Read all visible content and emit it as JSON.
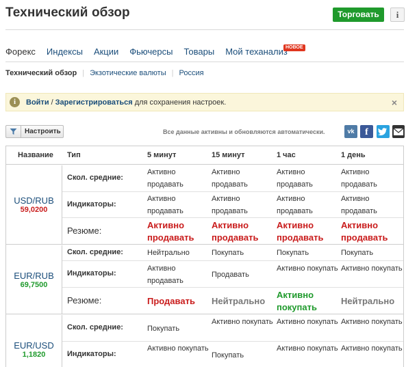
{
  "header": {
    "title": "Технический обзор",
    "trade_label": "Торговать",
    "info_label": "i"
  },
  "nav": {
    "tabs": [
      "Форекс",
      "Индексы",
      "Акции",
      "Фьючерсы",
      "Товары",
      "Мой теханализ"
    ],
    "new_badge": "НОВОЕ"
  },
  "subnav": {
    "items": [
      "Технический обзор",
      "Экзотические валюты",
      "Россия"
    ]
  },
  "notice": {
    "icon": "info-circle-icon",
    "login": "Войти",
    "separator": "/",
    "register": "Зарегистрироваться",
    "rest": "для сохранения настроек.",
    "close": "×"
  },
  "toolbar": {
    "configure_label": "Настроить",
    "auto_text": "Все данные активны и обновляются автоматически.",
    "share_icons": [
      "vk-icon",
      "facebook-icon",
      "twitter-icon",
      "mail-icon"
    ],
    "vk": "vk",
    "fb": "f"
  },
  "table": {
    "headers": [
      "Название",
      "Тип",
      "5 минут",
      "15 минут",
      "1 час",
      "1 день"
    ],
    "labels": {
      "ma": "Скол. средние:",
      "ind": "Индикаторы:",
      "sum": "Резюме:"
    },
    "groups": [
      {
        "pair": "USD/RUB",
        "price": "59,0200",
        "price_color": "#c91c1c",
        "ma": [
          "Активно продавать",
          "Активно продавать",
          "Активно продавать",
          "Активно продавать"
        ],
        "ind": [
          "Активно продавать",
          "Активно продавать",
          "Активно продавать",
          "Активно продавать"
        ],
        "sum": [
          "Активно продавать",
          "Активно продавать",
          "Активно продавать",
          "Активно продавать"
        ]
      },
      {
        "pair": "EUR/RUB",
        "price": "69,7500",
        "price_color": "#1f9a2c",
        "ma": [
          "Нейтрально",
          "Покупать",
          "Покупать",
          "Покупать"
        ],
        "ind": [
          "Активно продавать",
          "Продавать",
          "Активно покупать",
          "Активно покупать"
        ],
        "sum": [
          "Продавать",
          "Нейтрально",
          "Активно покупать",
          "Нейтрально"
        ]
      },
      {
        "pair": "EUR/USD",
        "price": "1,1820",
        "price_color": "#1f9a2c",
        "ma": [
          "Покупать",
          "Активно покупать",
          "Активно покупать",
          "Активно покупать"
        ],
        "ind": [
          "Активно покупать",
          "Покупать",
          "Активно покупать",
          "Активно покупать"
        ]
      }
    ]
  },
  "colors": {
    "sell": "#c91c1c",
    "buy": "#1f9a2c",
    "neutral": "#777777",
    "trade_button": "#1f9a2c",
    "link": "#1a4d7a"
  }
}
